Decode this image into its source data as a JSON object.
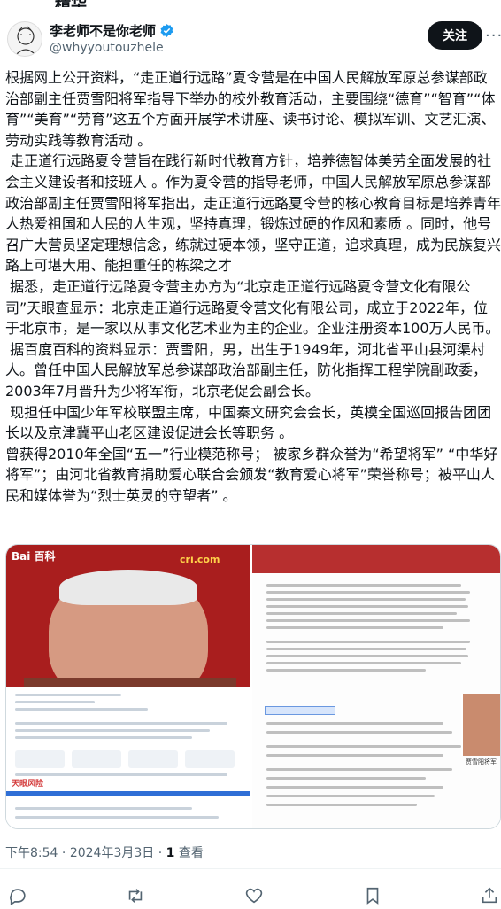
{
  "header": {
    "partial_top_text": "精华",
    "display_name": "李老师不是你老师",
    "handle": "@whyyoutouzhele",
    "follow_label": "关注",
    "more_label": "···"
  },
  "tweet": {
    "paragraphs": [
      "根据网上公开资料，“走正道行远路”夏令营是在中国人民解放军原总参谋部政治部副主任贾雪阳将军指导下举办的校外教育活动，主要围绕“德育”“智育”“体育”“美育”“劳育”这五个方面开展学术讲座、读书讨论、模拟军训、文艺汇演、劳动实践等教育活动 。",
      " 走正道行远路夏令营旨在践行新时代教育方针，培养德智体美劳全面发展的社会主义建设者和接班人 。作为夏令营的指导老师，中国人民解放军原总参谋部政治部副主任贾雪阳将军指出，走正道行远路夏令营的核心教育目标是培养青年人热爱祖国和人民的人生观，坚持真理，锻炼过硬的作风和素质 。同时，他号召广大营员坚定理想信念，练就过硬本领，坚守正道，追求真理，成为民族复兴路上可堪大用、能担重任的栋梁之才",
      " 据悉，走正道行远路夏令营主办方为“北京走正道行远路夏令营文化有限公司”天眼查显示：北京走正道行远路夏令营文化有限公司，成立于2022年，位于北京市，是一家以从事文化艺术业为主的企业。企业注册资本100万人民币。",
      " 据百度百科的资料显示：贾雪阳，男，出生于1949年，河北省平山县河渠村人。曾任中国人民解放军总参谋部政治部副主任，防化指挥工程学院副政委，2003年7月晋升为少将军衔，北京老促会副会长。",
      " 现担任中国少年军校联盟主席，中国秦文研究会会长，英模全国巡回报告团团长以及京津冀平山老区建设促进会长等职务 。",
      "曾获得2010年全国“五一”行业模范称号； 被家乡群众誉为“希望将军” “中华好将军”；由河北省教育捐助爱心联合会颁发“教育爱心将军”荣誉称号；被平山人民和媒体誉为“烈士英灵的守望者” 。"
    ]
  },
  "media": {
    "left_caption": "Bai 百科",
    "left_watermark": "cri.com",
    "left_footer": "天眼风险",
    "right_thumb_caption": "贾雪阳将军"
  },
  "meta": {
    "time": "下午8:54",
    "date": "2024年3月3日",
    "views_count": "1",
    "views_label": "查看"
  },
  "colors": {
    "follow_bg": "#0f1419",
    "verified": "#1d9bf0",
    "muted": "#536471"
  },
  "icons": [
    "reply-icon",
    "retweet-icon",
    "like-icon",
    "bookmark-icon",
    "share-icon",
    "verified-icon"
  ]
}
